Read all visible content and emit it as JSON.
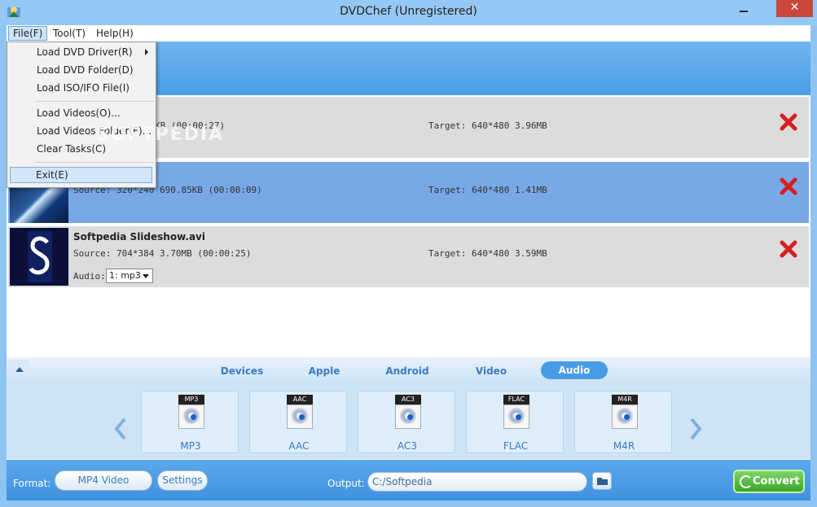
{
  "window": {
    "title": "DVDChef (Unregistered)",
    "close_glyph": "✕"
  },
  "menubar": {
    "file": "File(F)",
    "tool": "Tool(T)",
    "help": "Help(H)"
  },
  "file_menu": {
    "items": [
      "Load DVD Driver(R)",
      "Load DVD Folder(D)",
      "Load ISO/IFO File(I)",
      "Load Videos(O)...",
      "Load Videos Folder(F)...",
      "Clear Tasks(C)",
      "Exit(E)"
    ]
  },
  "tasks": [
    {
      "source": "KB (00:00:27)",
      "target": "Target: 640*480 3.96MB"
    },
    {
      "source": "Source: 320*240 690.85KB (00:00:09)",
      "target": "Target: 640*480 1.41MB"
    },
    {
      "name": "Softpedia Slideshow.avi",
      "source": "Source: 704*384 3.70MB (00:00:25)",
      "target": "Target: 640*480 3.59MB",
      "audio_label": "Audio:",
      "audio_value": "1: mp3"
    }
  ],
  "tabs": {
    "devices": "Devices",
    "apple": "Apple",
    "android": "Android",
    "video": "Video",
    "audio": "Audio",
    "active": "Audio"
  },
  "formats": [
    {
      "tag": "MP3",
      "label": "MP3"
    },
    {
      "tag": "AAC",
      "label": "AAC"
    },
    {
      "tag": "AC3",
      "label": "AC3"
    },
    {
      "tag": "FLAC",
      "label": "FLAC"
    },
    {
      "tag": "M4R",
      "label": "M4R"
    }
  ],
  "bottom": {
    "format_label": "Format:",
    "format_value": "MP4 Video",
    "settings": "Settings",
    "output_label": "Output:",
    "output_value": "C:/Softpedia",
    "convert": "Convert"
  },
  "watermark": "SOFTPEDIA",
  "colors": {
    "accent": "#4a9be6",
    "delete": "#d42020",
    "convert": "#3aa62a"
  }
}
